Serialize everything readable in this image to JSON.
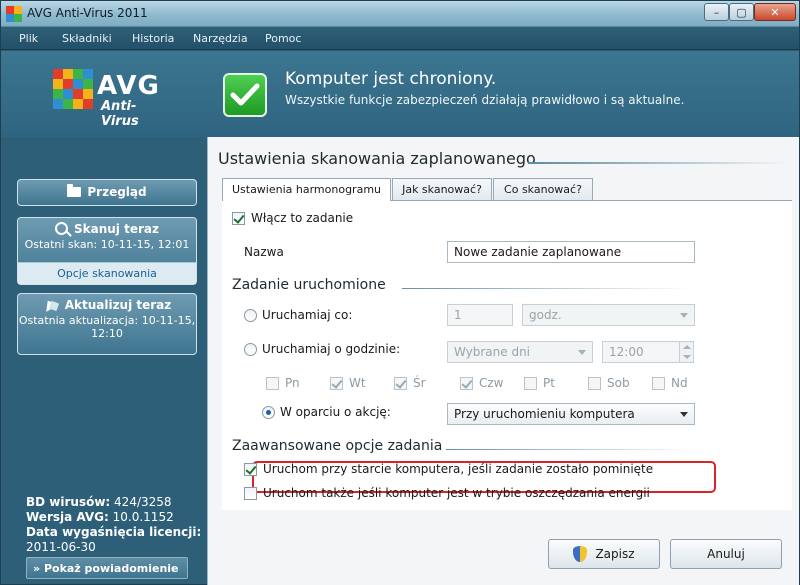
{
  "window": {
    "title": "AVG Anti-Virus 2011"
  },
  "menu": [
    "Plik",
    "Składniki",
    "Historia",
    "Narzędzia",
    "Pomoc"
  ],
  "logo": {
    "brand": "AVG",
    "product": "Anti-Virus"
  },
  "status": {
    "title": "Komputer jest chroniony.",
    "subtitle": "Wszystkie funkcje zabezpieczeń działają prawidłowo i są aktualne.",
    "color": "#2fb22f"
  },
  "sidebar": {
    "overview": {
      "label": "Przegląd",
      "icon": "folder-icon"
    },
    "scan": {
      "label": "Skanuj teraz",
      "sub": "Ostatni skan: 10-11-15, 12:01",
      "link": "Opcje skanowania",
      "icon": "magnifier-icon"
    },
    "update": {
      "label": "Aktualizuj teraz",
      "sub1": "Ostatnia aktualizacja: 10-11-15,",
      "sub2": "12:10",
      "icon": "update-icon"
    },
    "info": {
      "virus_db_label": "BD wirusów:",
      "virus_db_value": "424/3258",
      "version_label": "Wersja AVG:",
      "version_value": "10.0.1152",
      "license_label": "Data wygaśnięcia licencji:",
      "license_value": "2011-06-30"
    },
    "notification": "Pokaż powiadomienie"
  },
  "panel": {
    "title": "Ustawienia skanowania zaplanowanego",
    "tabs": [
      "Ustawienia harmonogramu",
      "Jak skanować?",
      "Co skanować?"
    ],
    "enable_task": {
      "label": "Włącz to zadanie",
      "checked": true
    },
    "name": {
      "label": "Nazwa",
      "value": "Nowe zadanie zaplanowane"
    },
    "run_section": "Zadanie uruchomione",
    "run_every": {
      "label": "Uruchamiaj co:",
      "value": "1",
      "unit": "godz."
    },
    "run_at": {
      "label": "Uruchamiaj o godzinie:",
      "days": "Wybrane dni",
      "time": "12:00"
    },
    "weekdays": [
      {
        "label": "Pn",
        "checked": false
      },
      {
        "label": "Wt",
        "checked": true
      },
      {
        "label": "Śr",
        "checked": true
      },
      {
        "label": "Czw",
        "checked": true
      },
      {
        "label": "Pt",
        "checked": false
      },
      {
        "label": "Sob",
        "checked": false
      },
      {
        "label": "Nd",
        "checked": false
      }
    ],
    "action_based": {
      "label": "W oparciu o akcję:",
      "value": "Przy uruchomieniu komputera",
      "selected": true
    },
    "advanced_section": "Zaawansowane opcje zadania",
    "advanced": [
      {
        "label": "Uruchom przy starcie komputera, jeśli zadanie zostało pominięte",
        "checked": true
      },
      {
        "label": "Uruchom także jeśli komputer jest w trybie oszczędzania energii",
        "checked": false
      }
    ],
    "save": "Zapisz",
    "cancel": "Anuluj"
  },
  "window_controls": {
    "minimize": "–",
    "maximize": "▢",
    "close": "✕"
  }
}
